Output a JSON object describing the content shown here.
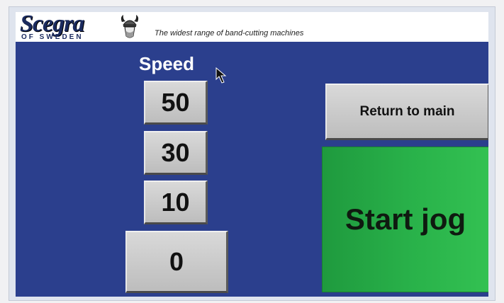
{
  "brand": {
    "logo_text": "Scegra",
    "logo_subtext": "OF SWEDEN",
    "tagline": "The widest range of band-cutting machines"
  },
  "speed": {
    "label": "Speed",
    "options": [
      "50",
      "30",
      "10",
      "0"
    ]
  },
  "buttons": {
    "return_label": "Return to main",
    "start_label": "Start jog"
  },
  "colors": {
    "screen_background": "#2b3f8d",
    "start_button": "#29b24a",
    "button_gray": "#c8c8c8"
  },
  "icons": [
    "viking-helmet-icon",
    "mouse-cursor-icon"
  ]
}
